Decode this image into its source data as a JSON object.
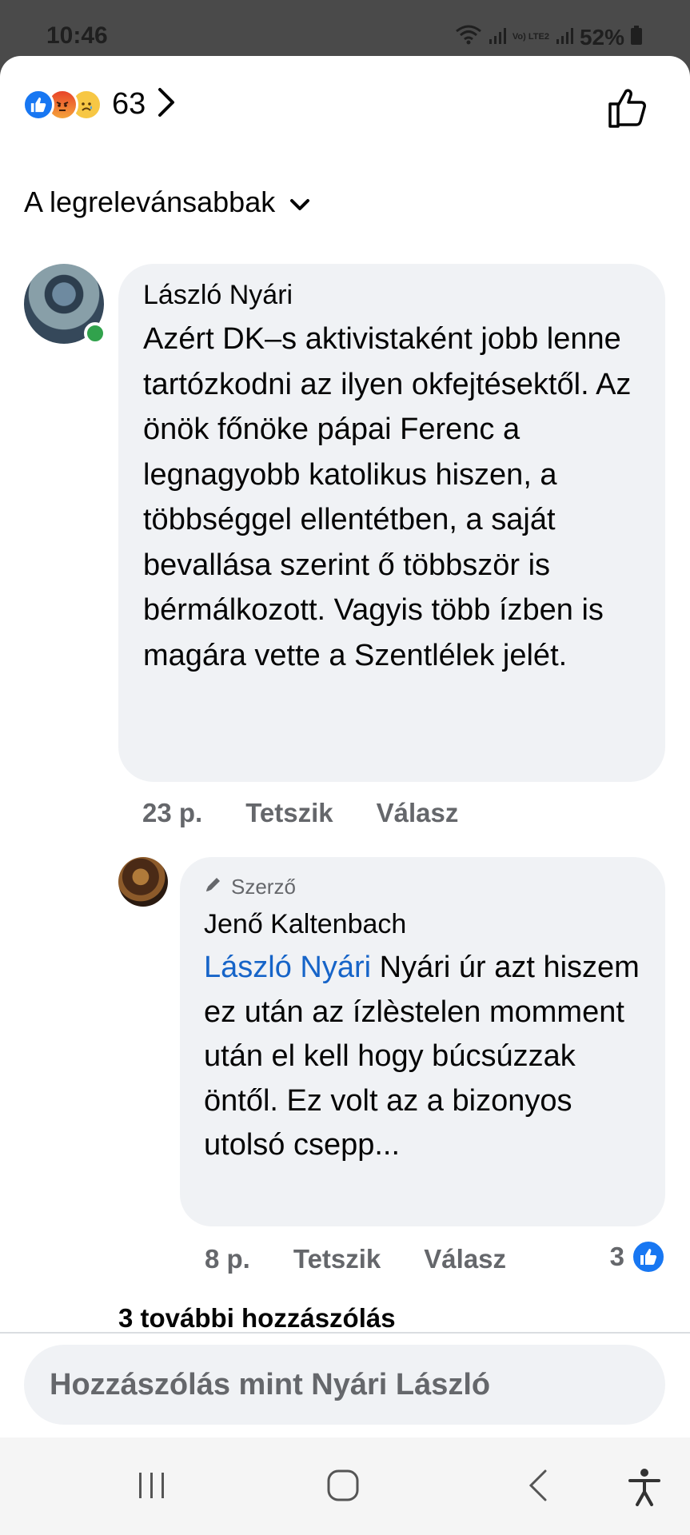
{
  "status_bar": {
    "time": "10:46",
    "network_label": "Vo) LTE2",
    "battery": "52%"
  },
  "reactions": {
    "types": [
      "like",
      "angry",
      "sad"
    ],
    "count": "63"
  },
  "sort": {
    "label": "A legrelevánsabbak"
  },
  "comments": [
    {
      "author": "László Nyári",
      "text": "Azért  DK–s aktivistaként jobb lenne tartózkodni az ilyen okfejtésektől. Az önök főnöke pápai Ferenc a legnagyobb katolikus hiszen, a többséggel ellentétben, a saját bevallása szerint ő többször is bérmálkozott. Vagyis több ízben is magára vette a Szentlélek jelét.",
      "time": "23 p.",
      "like_label": "Tetszik",
      "reply_label": "Válasz",
      "online": true
    }
  ],
  "reply": {
    "badge": "Szerző",
    "author": "Jenő Kaltenbach",
    "mention": "László Nyári",
    "text": " Nyári úr azt hiszem ez után az ízlèstelen momment után el kell hogy búcsúzzak öntől. Ez volt az a bizonyos utolsó csepp...",
    "time": "8 p.",
    "like_label": "Tetszik",
    "reply_label": "Válasz",
    "like_count": "3"
  },
  "more_replies": "3 további hozzászólás",
  "composer": {
    "placeholder": "Hozzászólás mint Nyári László"
  },
  "colors": {
    "accent": "#1877f2",
    "mention": "#1664c8",
    "bubble": "#f0f2f5",
    "meta": "#65676b",
    "online": "#31a24c"
  },
  "icons": [
    "wifi-icon",
    "signal-icon",
    "battery-icon",
    "like-reaction-icon",
    "angry-reaction-icon",
    "sad-reaction-icon",
    "chevron-right-icon",
    "thumbs-up-icon",
    "chevron-down-icon",
    "pencil-icon",
    "recents-icon",
    "home-icon",
    "back-icon",
    "accessibility-icon"
  ]
}
